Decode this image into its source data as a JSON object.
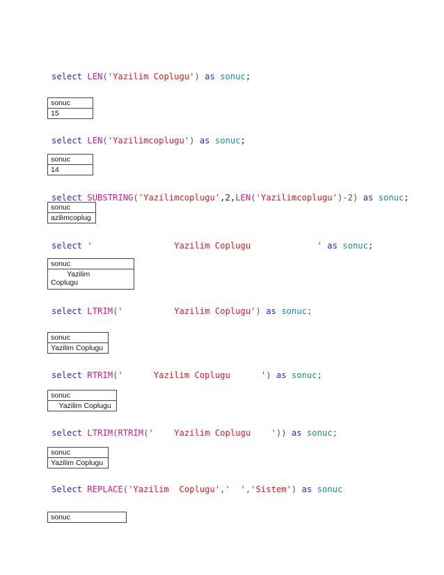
{
  "queries": [
    {
      "kw1": "select",
      "fn": "LEN",
      "p1": "(",
      "str": "'Yazilim Coplugu'",
      "p2": ") ",
      "as": "as",
      "alias": "sonuc",
      "end": ";",
      "header": "sonuc",
      "value": "15"
    },
    {
      "kw1": "select",
      "fn": "LEN",
      "p1": "(",
      "str": "'Yazilimcoplugu'",
      "p2": ") ",
      "as": "as",
      "alias": "sonuc",
      "end": ";",
      "header": "sonuc",
      "value": "14"
    },
    {
      "kw1": "select",
      "fn": "SUBSTRING",
      "p1": "(",
      "str": "'Yazilimcoplugu'",
      "mid1": ",2,",
      "fn2": "LEN",
      "p3": "(",
      "str2": "'Yazilimcoplugu'",
      "p4": ")-2) ",
      "as": "as",
      "alias": "sonuc",
      "end": ";",
      "header": "sonuc",
      "value": "azilimcoplug"
    },
    {
      "kw1": "select",
      "str": "'                Yazilim Coplugu             '",
      "as": "as",
      "alias": "sonuc",
      "end": ";",
      "header": "sonuc",
      "value_line1": "        Yazilim",
      "value_line2": "Coplugu"
    },
    {
      "kw1": "select",
      "fn": "LTRIM",
      "p1": "(",
      "str": "'          Yazilim Coplugu'",
      "p2": ") ",
      "as": "as",
      "alias": "sonuc",
      "end": ";",
      "header": "sonuc",
      "value": "Yazilim Coplugu"
    },
    {
      "kw1": "select",
      "fn": "RTRIM",
      "p1": "(",
      "str": "'      Yazilim Coplugu      '",
      "p2": ") ",
      "as": "as",
      "alias": "sonuc",
      "end": ";",
      "header": "sonuc",
      "value": "    Yazilim Coplugu"
    },
    {
      "kw1": "select",
      "fn": "LTRIM",
      "p1": "(",
      "fn2": "RTRIM",
      "p3": "(",
      "str": "'    Yazilim Coplugu    '",
      "p2": ")) ",
      "as": "as",
      "alias": "sonuc",
      "end": ";",
      "header": "sonuc",
      "value": "Yazilim Coplugu"
    },
    {
      "kw1": "Select",
      "fn": "REPLACE",
      "p1": "(",
      "str": "'Yazilim  Coplugu'",
      "mid1": ",",
      "str2": "'  '",
      "mid2": ",",
      "str3": "'Sistem'",
      "p2": ") ",
      "as": "as",
      "alias": "sonuc",
      "header": "sonuc"
    }
  ]
}
